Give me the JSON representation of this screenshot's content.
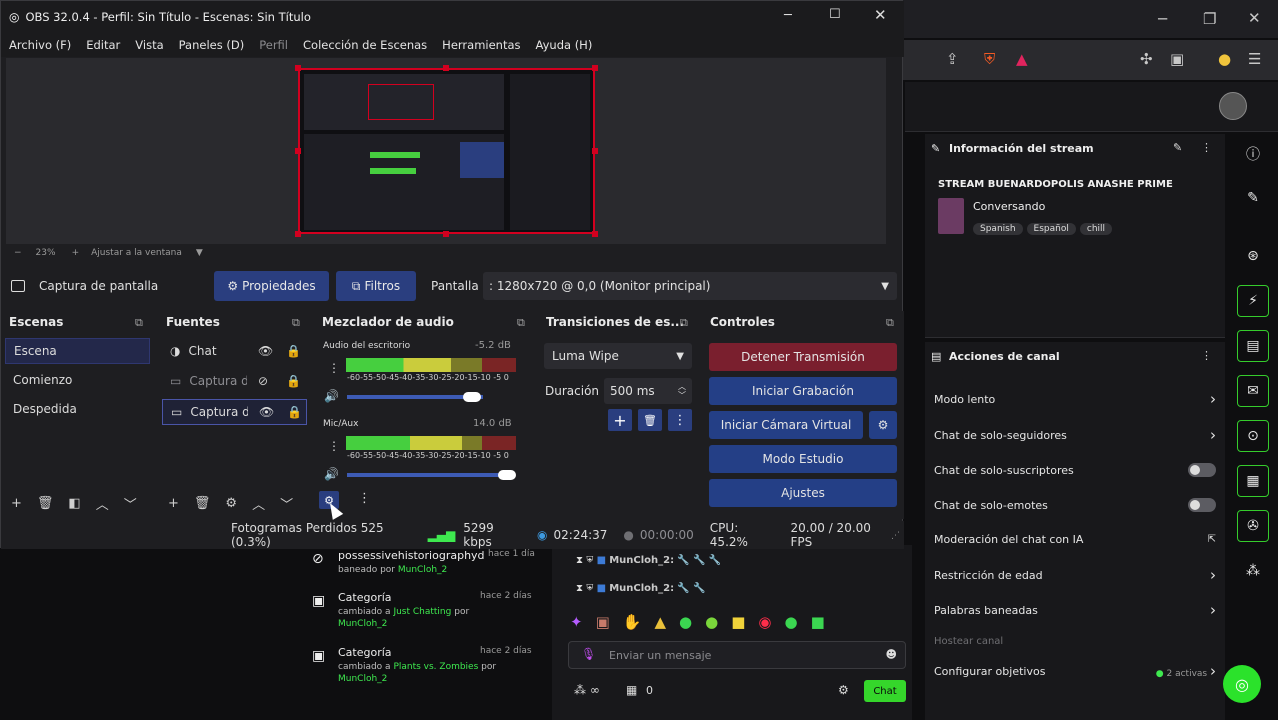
{
  "obs": {
    "title": "OBS 32.0.4 - Perfil: Sin Título - Escenas: Sin Título",
    "menu": [
      "Archivo (F)",
      "Editar",
      "Vista",
      "Paneles (D)",
      "Perfil",
      "Colección de Escenas",
      "Herramientas",
      "Ayuda (H)"
    ],
    "zoom": {
      "minus": "−",
      "percent": "23%",
      "plus": "+",
      "fit": "Ajustar a la ventana",
      "caret": "▼"
    },
    "source_toolbar": {
      "source_name": "Captura de pantalla",
      "properties": "Propiedades",
      "filters": "Filtros",
      "screen_label": "Pantalla",
      "screen_value": ": 1280x720 @ 0,0 (Monitor principal)"
    },
    "scenes": {
      "title": "Escenas",
      "items": [
        "Escena",
        "Comienzo",
        "Despedida"
      ]
    },
    "sources": {
      "title": "Fuentes",
      "items": [
        "Chat",
        "Captura de",
        "Captura de"
      ]
    },
    "mixer": {
      "title": "Mezclador de audio",
      "channels": [
        {
          "name": "Audio del escritorio",
          "db": "-5.2 dB",
          "level": 0.62
        },
        {
          "name": "Mic/Aux",
          "db": "14.0 dB",
          "level": 0.68
        }
      ],
      "scale": "-60-55-50-45-40-35-30-25-20-15-10 -5 0"
    },
    "transitions": {
      "title": "Transiciones de es...",
      "type": "Luma Wipe",
      "duration_label": "Duración",
      "duration_value": "500 ms"
    },
    "controls": {
      "title": "Controles",
      "stop_stream": "Detener Transmisión",
      "start_recording": "Iniciar Grabación",
      "virtual_cam": "Iniciar Cámara Virtual",
      "studio_mode": "Modo Estudio",
      "settings": "Ajustes"
    },
    "status": {
      "dropped": "Fotogramas Perdidos 525 (0.3%)",
      "bitrate": "5299 kbps",
      "live_time": "02:24:37",
      "rec_time": "00:00:00",
      "cpu": "CPU: 45.2%",
      "fps": "20.00 / 20.00 FPS"
    },
    "colors": {
      "accent": "#2a3e7f",
      "stop": "#7a1f2e",
      "selection": "#d2001f"
    }
  },
  "twitch": {
    "stream_info": {
      "header": "Información del stream",
      "title": "STREAM BUENARDOPOLIS ANASHE PRIME",
      "category": "Conversando",
      "tags": [
        "Spanish",
        "Español",
        "chill"
      ]
    },
    "channel_actions": {
      "header": "Acciones de canal",
      "rows": [
        {
          "label": "Modo lento",
          "kind": "arrow"
        },
        {
          "label": "Chat de solo-seguidores",
          "kind": "arrow"
        },
        {
          "label": "Chat de solo-suscriptores",
          "kind": "toggle"
        },
        {
          "label": "Chat de solo-emotes",
          "kind": "toggle"
        },
        {
          "label": "Moderación del chat con IA",
          "kind": "external"
        },
        {
          "label": "Restricción de edad",
          "kind": "arrow"
        },
        {
          "label": "Palabras baneadas",
          "kind": "arrow"
        },
        {
          "label": "Hostear canal",
          "kind": "disabled"
        },
        {
          "label": "Configurar objetivos",
          "kind": "goal"
        }
      ],
      "goals_active": "2 activas"
    },
    "activity": [
      {
        "title": "possessivehistoriographyd",
        "time": "hace 1 día",
        "line1": "baneado por",
        "user": "MunCloh_2"
      },
      {
        "title": "Categoría",
        "time": "hace 2 días",
        "line1": "cambiado a",
        "target": "Just Chatting",
        "by": "por",
        "user": "MunCloh_2"
      },
      {
        "title": "Categoría",
        "time": "hace 2 días",
        "line1": "cambiado a",
        "target": "Plants vs. Zombies",
        "by": "por",
        "user": "MunCloh_2"
      }
    ],
    "chat": {
      "users": [
        "MunCloh_2:",
        "MunCloh_2:"
      ],
      "placeholder": "Enviar un mensaje",
      "points": "0",
      "send": "Chat"
    }
  }
}
